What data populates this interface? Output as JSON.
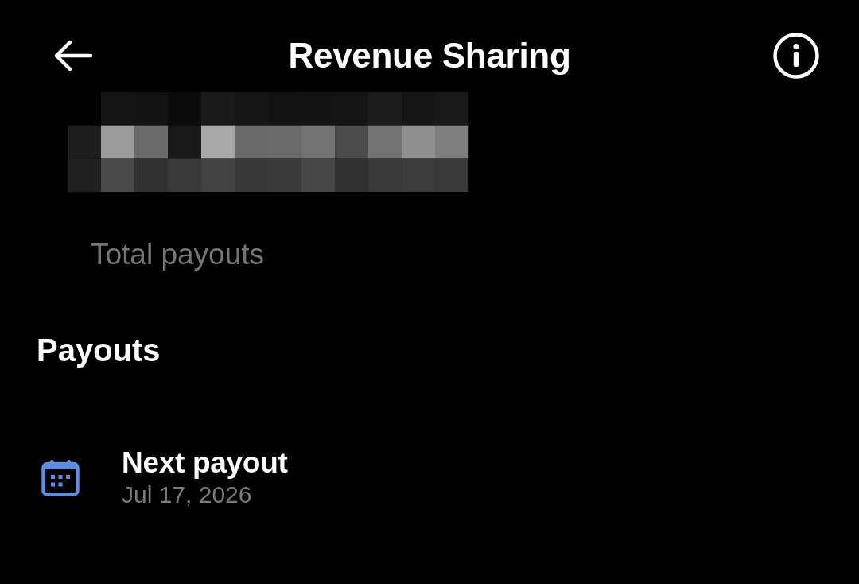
{
  "header": {
    "title": "Revenue Sharing"
  },
  "summary": {
    "label": "Total payouts"
  },
  "payouts": {
    "heading": "Payouts",
    "items": [
      {
        "title": "Next payout",
        "date": "Jul 17, 2026"
      }
    ]
  }
}
